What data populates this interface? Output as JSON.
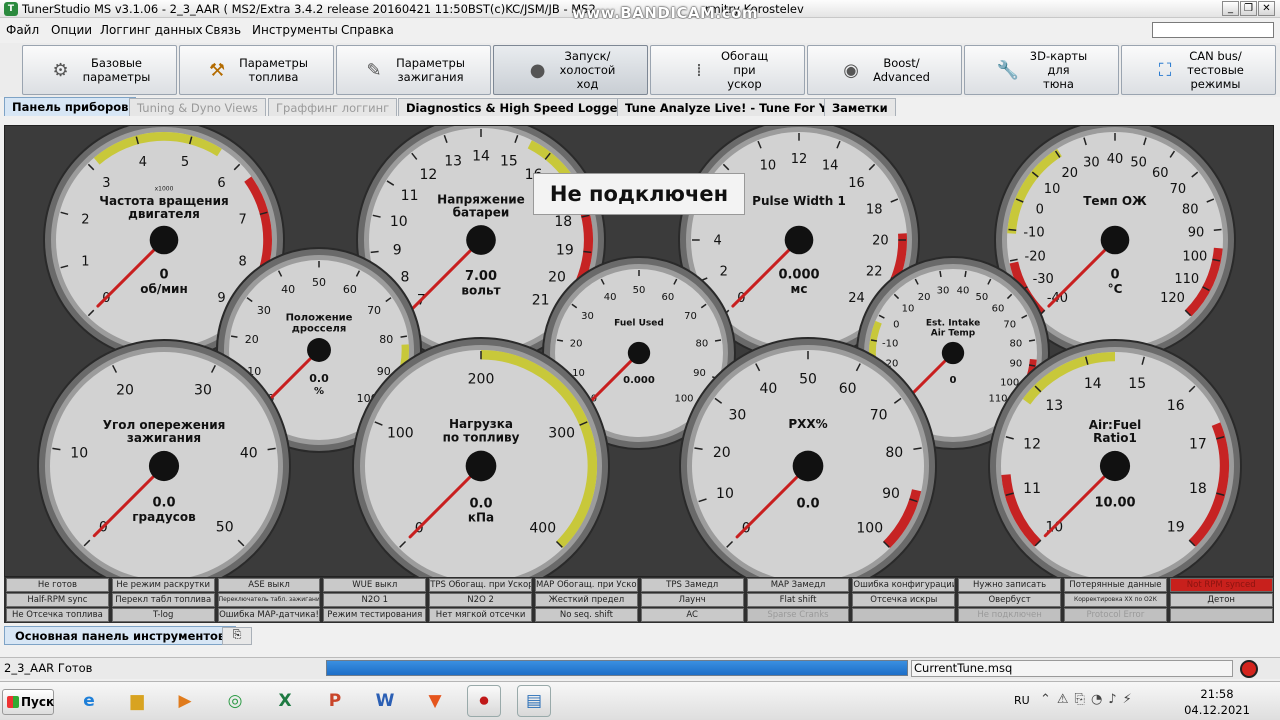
{
  "window": {
    "title": "TunerStudio MS v3.1.06 - 2_3_AAR ( MS2/Extra 3.4.2 release  20160421 11:50BST(c)KC/JSM/JB -  MS2",
    "title_suffix": "rmitry Korostelev",
    "overlay": "www.BANDICAM.com"
  },
  "menu": [
    "Файл",
    "Опции",
    "Логгинг данных",
    "Связь",
    "Инструменты",
    "Справка"
  ],
  "toolbar": [
    {
      "label": "Базовые\nпараметры",
      "icon": "gear-icon"
    },
    {
      "label": "Параметры\nтоплива",
      "icon": "injector-icon"
    },
    {
      "label": "Параметры\nзажигания",
      "icon": "spark-plug-icon"
    },
    {
      "label": "Запуск/\nхолостой\nход",
      "icon": "key-icon"
    },
    {
      "label": "Обогащ\nпри\nускор",
      "icon": "accel-icon"
    },
    {
      "label": "Boost/\nAdvanced",
      "icon": "turbo-icon"
    },
    {
      "label": "3D-карты\nдля\nтюна",
      "icon": "wrench-icon"
    },
    {
      "label": "CAN bus/\nтестовые\nрежимы",
      "icon": "network-icon"
    }
  ],
  "tabs": [
    {
      "label": "Панель приборов",
      "state": "selected"
    },
    {
      "label": "Tuning & Dyno Views",
      "state": "disabled"
    },
    {
      "label": "Граффинг логгинг",
      "state": "disabled"
    },
    {
      "label": "Diagnostics & High Speed Loggers",
      "state": "normal"
    },
    {
      "label": "Tune Analyze Live! - Tune For You",
      "state": "normal"
    },
    {
      "label": "Заметки",
      "state": "normal"
    }
  ],
  "not_connected": "Не подключен",
  "gauges": [
    {
      "id": "rpm",
      "title": [
        "Частота вращения",
        "двигателя"
      ],
      "small": "x1000",
      "value": "0",
      "units": "об/мин",
      "min": 0,
      "max": 9,
      "ticks": [
        "0",
        "1",
        "2",
        "3",
        "4",
        "5",
        "6",
        "7",
        "8",
        "9"
      ],
      "needle": 0
    },
    {
      "id": "volts",
      "title": [
        "Напряжение",
        "батареи"
      ],
      "value": "7.00",
      "units": "вольт",
      "min": 7,
      "max": 21,
      "ticks": [
        "7",
        "8",
        "9",
        "10",
        "11",
        "12",
        "13",
        "14",
        "15",
        "16",
        "17",
        "18",
        "19",
        "20",
        "21"
      ],
      "needle": 7
    },
    {
      "id": "pw",
      "title": [
        "Pulse Width 1"
      ],
      "value": "0.000",
      "units": "мс",
      "min": 0,
      "max": 24,
      "ticks": [
        "0",
        "2",
        "4",
        "6",
        "8",
        "10",
        "12",
        "14",
        "16",
        "18",
        "20",
        "22",
        "24"
      ],
      "needle": 0
    },
    {
      "id": "clt",
      "title": [
        "Темп ОЖ"
      ],
      "value": "0",
      "units": "°C",
      "min": -40,
      "max": 120,
      "ticks": [
        "-40",
        "-30",
        "-20",
        "-10",
        "0",
        "10",
        "20",
        "30",
        "40",
        "50",
        "60",
        "70",
        "80",
        "90",
        "100",
        "110",
        "120"
      ],
      "needle": -40
    },
    {
      "id": "tps",
      "title": [
        "Положение",
        "дросселя"
      ],
      "value": "0.0",
      "units": "%",
      "min": 0,
      "max": 100,
      "ticks": [
        "0",
        "10",
        "20",
        "30",
        "40",
        "50",
        "60",
        "70",
        "80",
        "90",
        "100"
      ],
      "needle": 0
    },
    {
      "id": "fuel",
      "title": [
        "Fuel Used"
      ],
      "value": "0.000",
      "units": "",
      "min": 0,
      "max": 100,
      "ticks": [
        "0",
        "10",
        "20",
        "30",
        "40",
        "50",
        "60",
        "70",
        "80",
        "90",
        "100"
      ],
      "needle": 0
    },
    {
      "id": "iat",
      "title": [
        "Est. Intake",
        "Air Temp"
      ],
      "value": "0",
      "units": "",
      "min": -40,
      "max": 110,
      "ticks": [
        "-40",
        "-30",
        "-20",
        "-10",
        "0",
        "10",
        "20",
        "30",
        "40",
        "50",
        "60",
        "70",
        "80",
        "90",
        "100",
        "110"
      ],
      "needle": -40
    },
    {
      "id": "adv",
      "title": [
        "Угол опережения",
        "зажигания"
      ],
      "value": "0.0",
      "units": "градусов",
      "min": 0,
      "max": 50,
      "ticks": [
        "0",
        "10",
        "20",
        "30",
        "40",
        "50"
      ],
      "needle": 0
    },
    {
      "id": "load",
      "title": [
        "Нагрузка",
        "по топливу"
      ],
      "value": "0.0",
      "units": "кПа",
      "min": 0,
      "max": 400,
      "ticks": [
        "0",
        "100",
        "200",
        "300",
        "400"
      ],
      "needle": 0
    },
    {
      "id": "iac",
      "title": [
        "РХХ%"
      ],
      "value": "0.0",
      "units": "",
      "min": 0,
      "max": 100,
      "ticks": [
        "0",
        "10",
        "20",
        "30",
        "40",
        "50",
        "60",
        "70",
        "80",
        "90",
        "100"
      ],
      "needle": 0
    },
    {
      "id": "afr",
      "title": [
        "Air:Fuel",
        "Ratio1"
      ],
      "value": "10.00",
      "units": "",
      "min": 10,
      "max": 19,
      "ticks": [
        "10",
        "11",
        "12",
        "13",
        "14",
        "15",
        "16",
        "17",
        "18",
        "19"
      ],
      "needle": 10
    }
  ],
  "indicators": [
    [
      "Не готов",
      "Не режим раскрутки",
      "ASE выкл",
      "WUE выкл",
      "TPS Обогащ. при Ускор",
      "MAP Обогащ. при Ускор",
      "TPS Замедл",
      "MAP Замедл",
      "Ошибка конфигурации",
      "Нужно записать",
      "Потерянные данные",
      "Not RPM synced"
    ],
    [
      "Half-RPM sync",
      "Перекл табл топлива",
      "Переключатель табл. зажигания",
      "N2O 1",
      "N2O 2",
      "Жесткий предел",
      "Лаунч",
      "Flat shift",
      "Отсечка искры",
      "Овербуст",
      "Корректировка ХХ по О2К",
      "Детон"
    ],
    [
      "Не Отсечка топлива",
      "T-log",
      "Ошибка MAP-датчика!",
      "Режим тестирования",
      "Нет мягкой отсечки",
      "No seq. shift",
      "AC",
      "Sparse Cranks",
      "",
      "Не подключен",
      "Protocol Error",
      ""
    ]
  ],
  "panel_tab": "Основная панель инструментов",
  "status": {
    "left": "2_3_AAR Готов",
    "file": "CurrentTune.msq"
  },
  "taskbar": {
    "start": "Пуск",
    "lang": "RU",
    "time": "21:58",
    "date": "04.12.2021"
  }
}
